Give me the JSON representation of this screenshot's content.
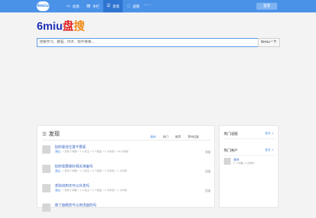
{
  "header": {
    "logo_text": "6miu",
    "nav": [
      {
        "label": "动态",
        "icon": "page-icon"
      },
      {
        "label": "专栏",
        "icon": "column-icon"
      },
      {
        "label": "发现",
        "icon": "list-icon"
      },
      {
        "label": "话题",
        "icon": "chat-icon"
      }
    ],
    "more": "···",
    "login_label": "登录",
    "colors": {
      "bar": "#4a92e8",
      "active": "#2f74d0"
    }
  },
  "site": {
    "title_part1": "6miu",
    "title_part2": "盘",
    "title_part3": "搜",
    "colors": {
      "part1": "#2030b8",
      "part2": "#e22121",
      "part3": "#f08a16"
    }
  },
  "search": {
    "placeholder": "搜索学习、教程、PDF、软件等等...",
    "button_label": "6miu一下"
  },
  "discover": {
    "title": "发现",
    "tabs": [
      "最新",
      "热门",
      "推荐",
      "等待回复"
    ],
    "items": [
      {
        "title": "刮痧最佳位置不要紧",
        "tag": "默认",
        "meta": "• 发布了问题 • 1 人关注 • 0 个回复 • 0 次浏览 • 28 分钟前",
        "reply": "回复"
      },
      {
        "title": "刮痧需要做好相关准备吗",
        "tag": "默认",
        "meta": "• 发布了问题 • 1 人关注 • 0 个回复 • 0 次浏览 • 1 小时前",
        "reply": "回复"
      },
      {
        "title": "发际线到天可以补发吗",
        "tag": "默认",
        "meta": "• 发布了问题 • 1 人关注 • 0 个回复 • 0 次浏览 • 1 小时前",
        "reply": "回复"
      },
      {
        "title": "做了面眼皮可以用洗面奶吗",
        "tag": "默认",
        "meta": "",
        "reply": ""
      }
    ]
  },
  "sidebar": {
    "hot_topics": "热门话题",
    "hot_users": "热门用户",
    "more": "更多 >",
    "user_name": "查询",
    "user_desc": "0 个问题, 0 次赞同"
  }
}
